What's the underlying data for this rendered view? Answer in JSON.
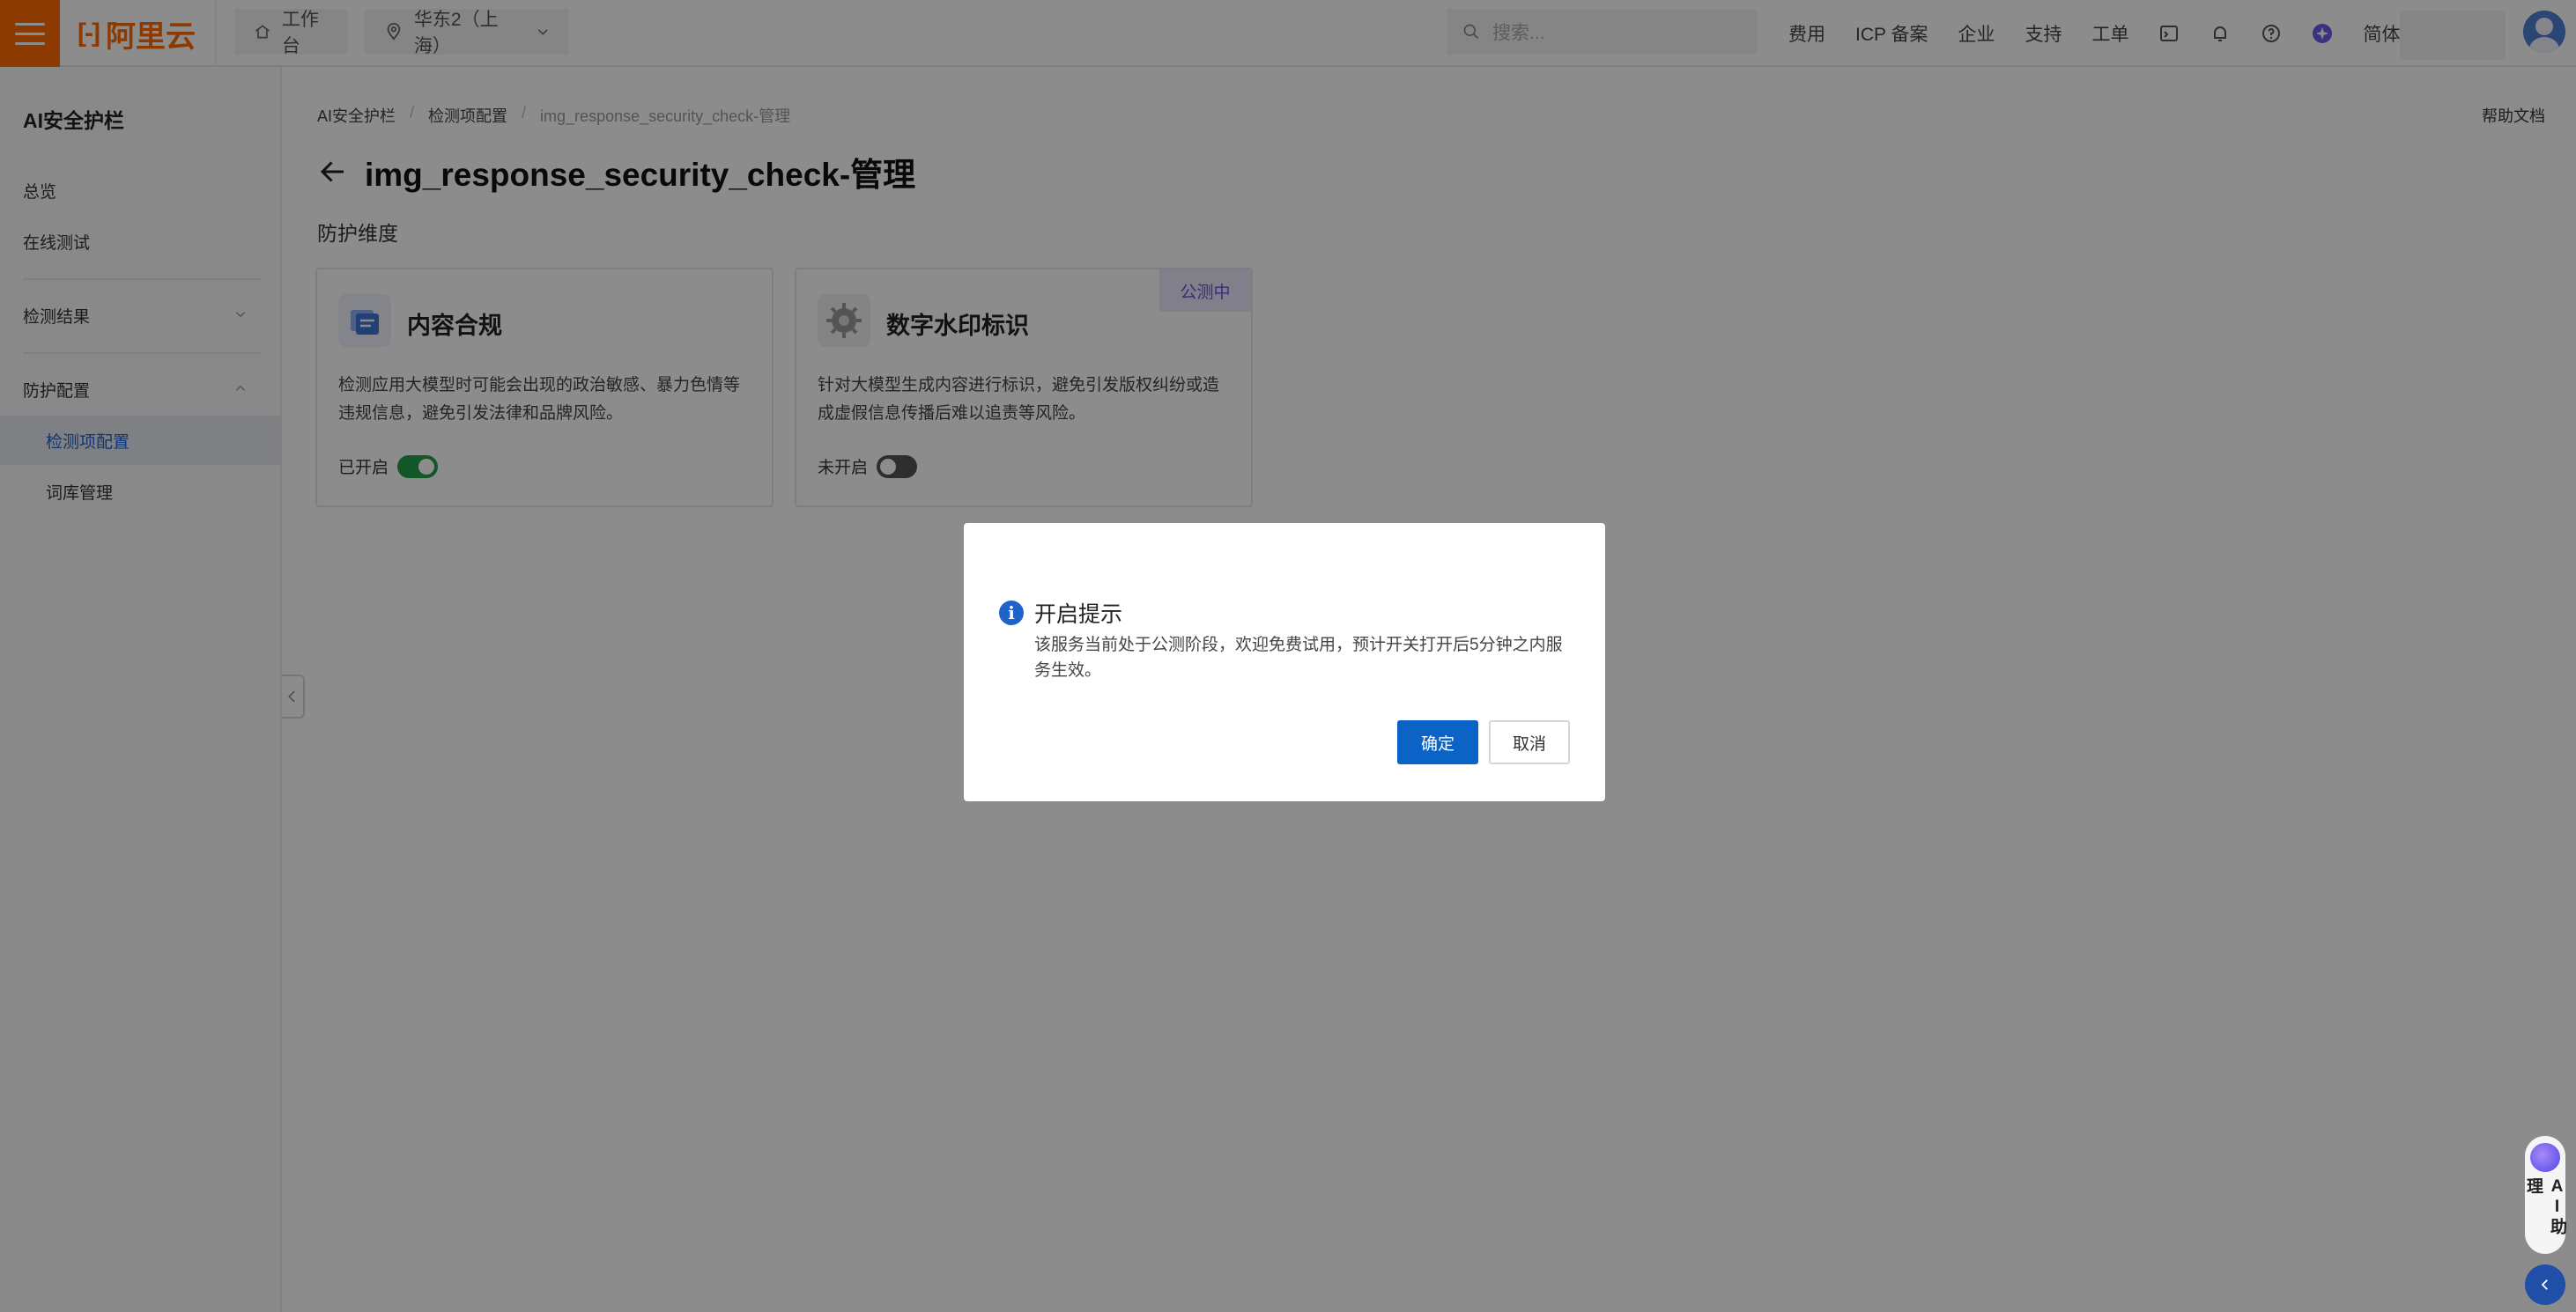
{
  "topbar": {
    "logo_text": "阿里云",
    "workbench_label": "工作台",
    "region_label": "华东2（上海）",
    "search_placeholder": "搜索...",
    "links": [
      "费用",
      "ICP 备案",
      "企业",
      "支持",
      "工单"
    ],
    "lang_label": "简体",
    "accent_color": "#ff6a00"
  },
  "sidebar": {
    "title": "AI安全护栏",
    "items": [
      {
        "label": "总览"
      },
      {
        "label": "在线测试"
      },
      {
        "label": "检测结果"
      },
      {
        "label": "防护配置"
      },
      {
        "label": "检测项配置"
      },
      {
        "label": "词库管理"
      }
    ]
  },
  "breadcrumb": [
    "AI安全护栏",
    "检测项配置",
    "img_response_security_check-管理"
  ],
  "help_doc_label": "帮助文档",
  "page_title": "img_response_security_check-管理",
  "section_title": "防护维度",
  "cards": [
    {
      "title": "内容合规",
      "description": "检测应用大模型时可能会出现的政治敏感、暴力色情等违规信息，避免引发法律和品牌风险。",
      "status_label": "已开启",
      "enabled": true,
      "icon": "document-shield-icon"
    },
    {
      "title": "数字水印标识",
      "description": "针对大模型生成内容进行标识，避免引发版权纠纷或造成虚假信息传播后难以追责等风险。",
      "status_label": "未开启",
      "enabled": false,
      "badge": "公测中",
      "icon": "watermark-gear-icon"
    }
  ],
  "modal": {
    "title": "开启提示",
    "body": "该服务当前处于公测阶段，欢迎免费试用，预计开关打开后5分钟之内服务生效。",
    "ok_label": "确定",
    "cancel_label": "取消",
    "info_color": "#1f62c8"
  },
  "ai_assistant": {
    "label": "AI助理"
  }
}
